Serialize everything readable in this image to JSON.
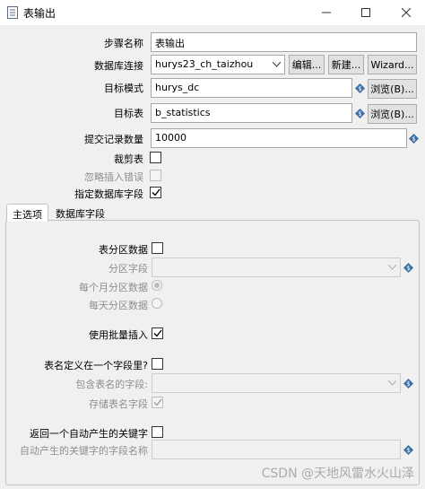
{
  "window": {
    "title": "表输出"
  },
  "form": {
    "step_name": {
      "label": "步骤名称",
      "value": "表输出"
    },
    "connection": {
      "label": "数据库连接",
      "value": "hurys23_ch_taizhou",
      "edit": "编辑...",
      "new": "新建...",
      "wizard": "Wizard..."
    },
    "schema": {
      "label": "目标模式",
      "value": "hurys_dc",
      "browse": "浏览(B)..."
    },
    "table": {
      "label": "目标表",
      "value": "b_statistics",
      "browse": "浏览(B)..."
    },
    "commit": {
      "label": "提交记录数量",
      "value": "10000"
    },
    "truncate": {
      "label": "裁剪表",
      "checked": false
    },
    "ignore_errors": {
      "label": "忽略插入错误",
      "checked": false
    },
    "specify_fields": {
      "label": "指定数据库字段",
      "checked": true
    }
  },
  "tabs": [
    {
      "label": "主选项",
      "active": true
    },
    {
      "label": "数据库字段",
      "active": false
    }
  ],
  "main": {
    "partition": {
      "label": "表分区数据",
      "checked": false
    },
    "partition_field": {
      "label": "分区字段",
      "value": ""
    },
    "monthly": {
      "label": "每个月分区数据",
      "selected": true
    },
    "daily": {
      "label": "每天分区数据",
      "selected": false
    },
    "batch": {
      "label": "使用批量插入",
      "checked": true
    },
    "table_in_field": {
      "label": "表名定义在一个字段里?",
      "checked": false
    },
    "table_name_field": {
      "label": "包含表名的字段:",
      "value": ""
    },
    "store_table_name": {
      "label": "存储表名字段",
      "checked": true
    },
    "return_key": {
      "label": "返回一个自动产生的关键字",
      "checked": false
    },
    "key_field_name": {
      "label": "自动产生的关键字的字段名称",
      "value": ""
    }
  },
  "watermark": "CSDN @天地风雷水火山泽"
}
